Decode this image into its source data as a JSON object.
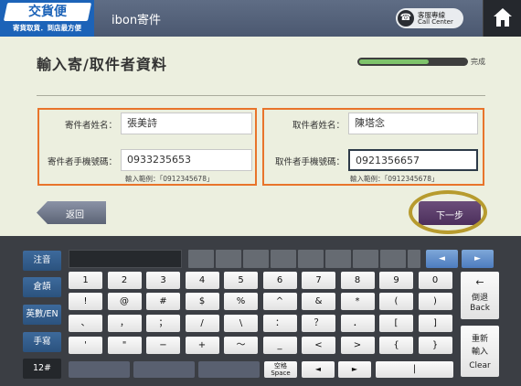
{
  "header": {
    "logo_main": "交貨便",
    "logo_sub": "寄貨取貨．到店最方便",
    "app_title": "ibon寄件",
    "call_center_line1": "客服專線",
    "call_center_line2": "Call Center"
  },
  "form": {
    "title": "輸入寄/取件者資料",
    "progress_label": "完成",
    "progress_fraction": 0.65,
    "sender": {
      "name_label": "寄件者姓名：",
      "name_value": "張美詩",
      "phone_label": "寄件者手機號碼：",
      "phone_value": "0933235653",
      "hint": "輸入範例：「0912345678」"
    },
    "receiver": {
      "name_label": "取件者姓名：",
      "name_value": "陳塔念",
      "phone_label": "取件者手機號碼：",
      "phone_value": "0921356657",
      "hint": "輸入範例：「0912345678」"
    },
    "back_label": "返回",
    "next_label": "下一步"
  },
  "keyboard": {
    "side_keys": [
      "注音",
      "倉頡",
      "英數/EN",
      "手寫",
      "12#"
    ],
    "rows": [
      [
        "1",
        "2",
        "3",
        "4",
        "5",
        "6",
        "7",
        "8",
        "9",
        "0"
      ],
      [
        "!",
        "@",
        "#",
        "$",
        "%",
        "^",
        "&",
        "*",
        "(",
        ")"
      ],
      [
        "、",
        "，",
        "；",
        "/",
        "\\",
        "：",
        "？",
        "．",
        "[",
        "]"
      ],
      [
        "'",
        "\"",
        "−",
        "+",
        "～",
        "_",
        "<",
        ">",
        "{",
        "}"
      ]
    ],
    "space_line1": "空格",
    "space_line2": "Space",
    "arrow_left": "◄",
    "arrow_right": "►",
    "bottom_arrow_left": "◄",
    "bottom_arrow_right": "►",
    "bottom_bar": "|",
    "backspace_arrow": "←",
    "backspace_line1": "倒退",
    "backspace_line2": "Back",
    "clear_line1": "重新",
    "clear_line2": "輸入",
    "clear_line3": "Clear"
  }
}
